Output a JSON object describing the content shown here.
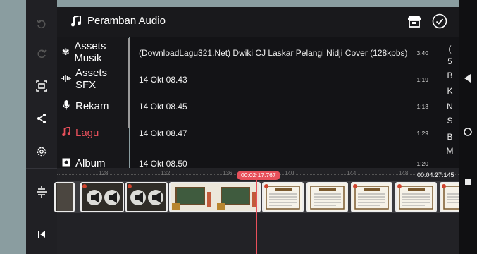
{
  "panel": {
    "title": "Peramban Audio"
  },
  "categories": [
    {
      "label": "Assets Musik",
      "icon": "music-assets-icon",
      "active": false
    },
    {
      "label": "Assets SFX",
      "icon": "sfx-icon",
      "active": false
    },
    {
      "label": "Rekam",
      "icon": "microphone-icon",
      "active": false
    },
    {
      "label": "Lagu",
      "icon": "music-note-icon",
      "active": true
    },
    {
      "label": "Album",
      "icon": "album-icon",
      "active": false
    }
  ],
  "files": [
    {
      "name": "(DownloadLagu321.Net) Dwiki CJ Laskar Pelangi Nidji Cover (128kpbs)",
      "duration": "3:40"
    },
    {
      "name": "14 Okt 08.43",
      "duration": "1:19"
    },
    {
      "name": "14 Okt 08.45",
      "duration": "1:13"
    },
    {
      "name": "14 Okt 08.47",
      "duration": "1:29"
    },
    {
      "name": "14 Okt 08.50",
      "duration": "1:20"
    }
  ],
  "index_letters": [
    "(",
    "5",
    "B",
    "K",
    "N",
    "S",
    "B",
    "M"
  ],
  "timeline": {
    "ticks": [
      "128",
      "132",
      "136",
      "140",
      "144",
      "148"
    ],
    "playhead_time": "00:02:17.767",
    "total_time": "00:04:27.145"
  },
  "colors": {
    "accent": "#e8505b",
    "active_category": "#e8505b"
  }
}
